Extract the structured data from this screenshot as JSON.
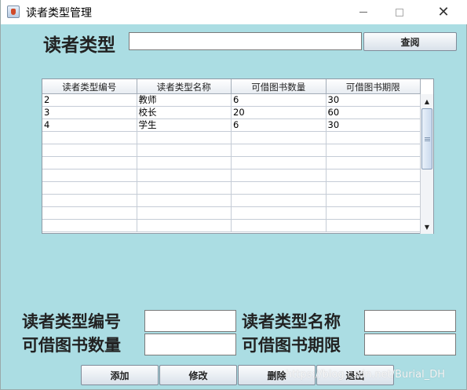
{
  "window": {
    "title": "读者类型管理",
    "close_glyph": "✕"
  },
  "search": {
    "label": "读者类型",
    "value": "",
    "button_label": "查阅"
  },
  "table": {
    "columns": [
      "读者类型编号",
      "读者类型名称",
      "可借图书数量",
      "可借图书期限"
    ],
    "rows": [
      [
        "2",
        "教师",
        "6",
        "30"
      ],
      [
        "3",
        "校长",
        "20",
        "60"
      ],
      [
        "4",
        "学生",
        "6",
        "30"
      ],
      [
        "",
        "",
        "",
        ""
      ],
      [
        "",
        "",
        "",
        ""
      ],
      [
        "",
        "",
        "",
        ""
      ],
      [
        "",
        "",
        "",
        ""
      ],
      [
        "",
        "",
        "",
        ""
      ],
      [
        "",
        "",
        "",
        ""
      ],
      [
        "",
        "",
        "",
        ""
      ],
      [
        "",
        "",
        "",
        ""
      ]
    ],
    "scroll_up_glyph": "▲",
    "scroll_down_glyph": "▼"
  },
  "form": {
    "type_id_label": "读者类型编号",
    "type_name_label": "读者类型名称",
    "borrow_count_label": "可借图书数量",
    "borrow_days_label": "可借图书期限",
    "type_id_value": "",
    "type_name_value": "",
    "borrow_count_value": "",
    "borrow_days_value": ""
  },
  "actions": {
    "add_label": "添加",
    "edit_label": "修改",
    "delete_label": "删除",
    "exit_label": "退出"
  },
  "watermark": "https://blog.csdn.net/Burial_DH",
  "colors": {
    "background": "#abdde3",
    "titlebar": "#ffffff"
  },
  "icons": {
    "app": "java-cup-icon",
    "minimize": "minimize-icon",
    "maximize": "maximize-icon",
    "close": "close-icon"
  }
}
